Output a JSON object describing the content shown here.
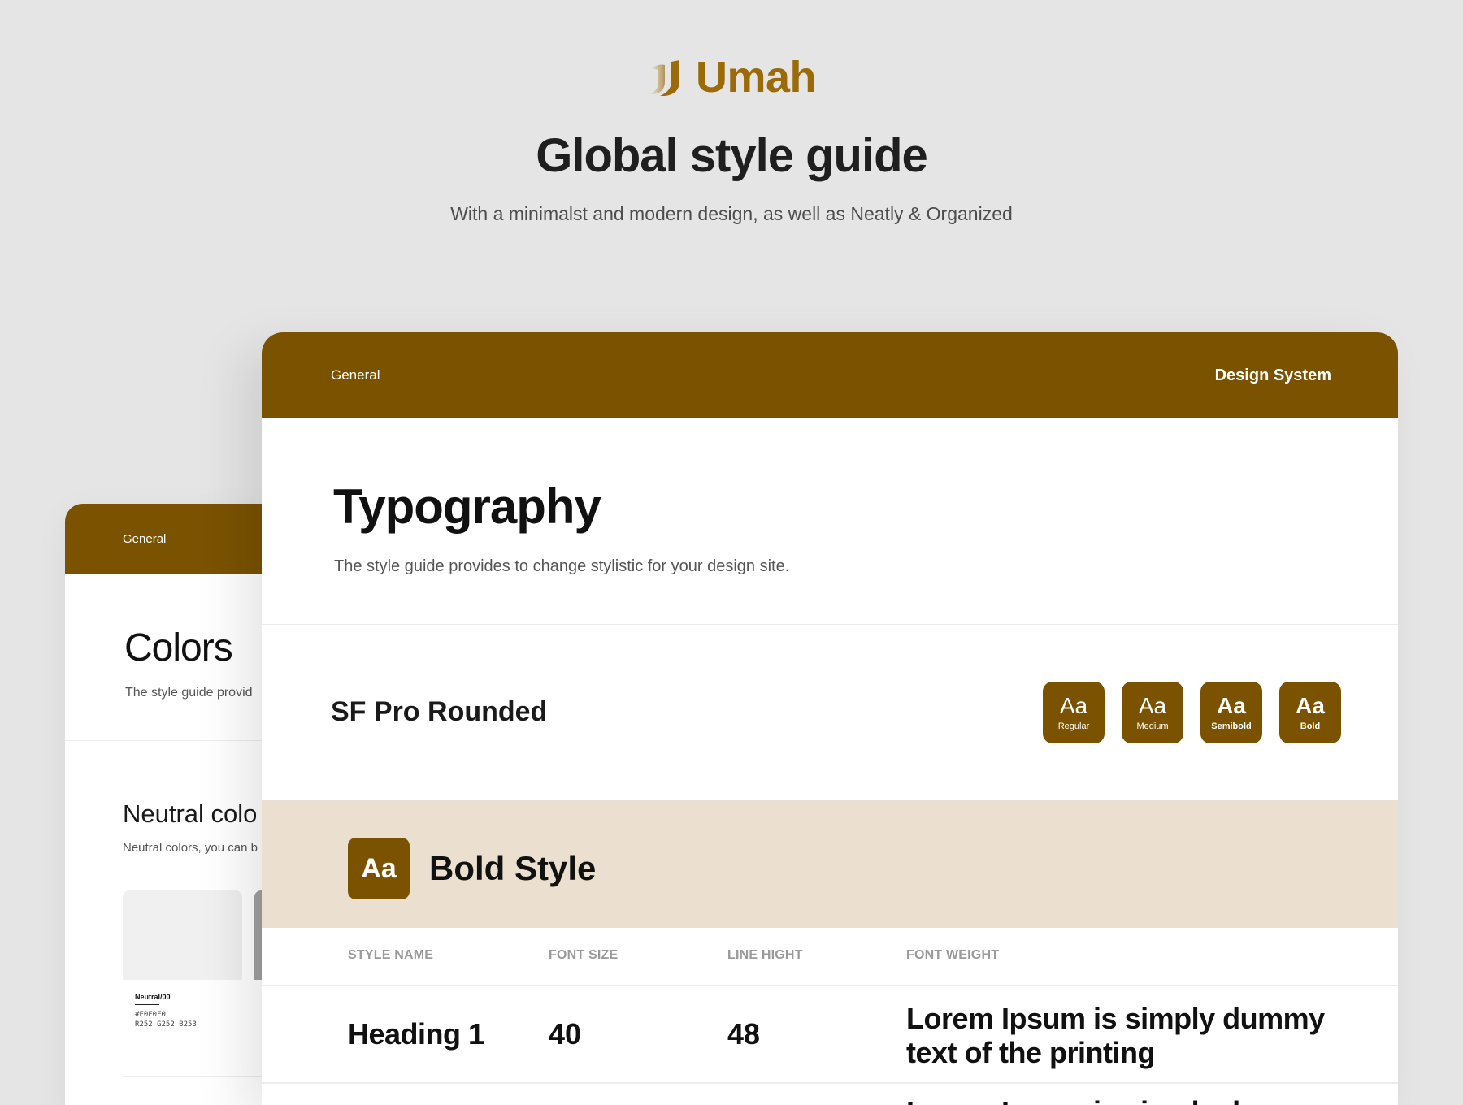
{
  "brand": {
    "name": "Umah",
    "color": "#9a6b08"
  },
  "hero": {
    "title": "Global style guide",
    "subtitle": "With a minimalst and modern design, as well as Neatly & Organized"
  },
  "colors_card": {
    "header_label": "General",
    "title": "Colors",
    "description": "The style guide provid",
    "section_title": "Neutral colo",
    "section_description": "Neutral colors, you can b",
    "swatch": {
      "name": "Neutral/00",
      "hex": "#F0F0F0",
      "rgb": "R252 G252 B253"
    }
  },
  "typography_card": {
    "header_left": "General",
    "header_right": "Design System",
    "title": "Typography",
    "description": "The style guide provides to change stylistic for your design site.",
    "font_name": "SF Pro Rounded",
    "weights": [
      {
        "glyph": "Aa",
        "label": "Regular"
      },
      {
        "glyph": "Aa",
        "label": "Medium"
      },
      {
        "glyph": "Aa",
        "label": "Semibold"
      },
      {
        "glyph": "Aa",
        "label": "Bold"
      }
    ],
    "band": {
      "glyph": "Aa",
      "title": "Bold Style"
    },
    "table": {
      "headers": [
        "STYLE NAME",
        "FONT SIZE",
        "LINE HIGHT",
        "FONT WEIGHT"
      ],
      "rows": [
        {
          "name": "Heading 1",
          "size": "40",
          "line_height": "48",
          "sample": "Lorem Ipsum is simply dummy text of the printing"
        }
      ],
      "next_row_sample": "Lorem Ipsum is simply dum"
    }
  },
  "theme": {
    "accent": "#7a5200",
    "band": "#ebe0cf",
    "background": "#e5e5e5"
  }
}
